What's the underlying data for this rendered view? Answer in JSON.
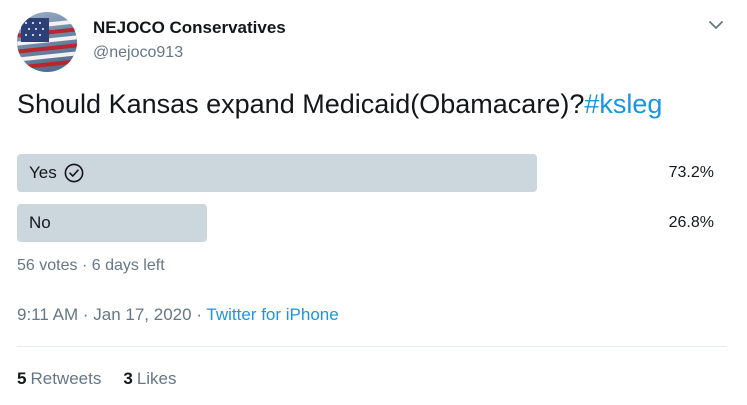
{
  "user": {
    "display_name": "NEJOCO Conservatives",
    "handle": "@nejoco913"
  },
  "tweet": {
    "text": "Should Kansas expand Medicaid(Obamacare)?",
    "hashtag": "#ksleg"
  },
  "poll": {
    "options": [
      {
        "label": "Yes",
        "percent_text": "73.2%",
        "percent": 73.2,
        "selected": true
      },
      {
        "label": "No",
        "percent_text": "26.8%",
        "percent": 26.8,
        "selected": false
      }
    ],
    "votes": "56 votes",
    "separator": "·",
    "time_left": "6 days left"
  },
  "meta": {
    "time": "9:11 AM",
    "separator": "·",
    "date": "Jan 17, 2020",
    "source": "Twitter for iPhone"
  },
  "stats": {
    "retweets_count": "5",
    "retweets_label": "Retweets",
    "likes_count": "3",
    "likes_label": "Likes"
  },
  "icons": {
    "menu": "chevron-down-icon",
    "selected": "check-circle-icon"
  },
  "colors": {
    "link": "#1b95e0",
    "poll_bar": "#ccd6dd",
    "secondary_text": "#657786",
    "primary_text": "#14171a"
  }
}
